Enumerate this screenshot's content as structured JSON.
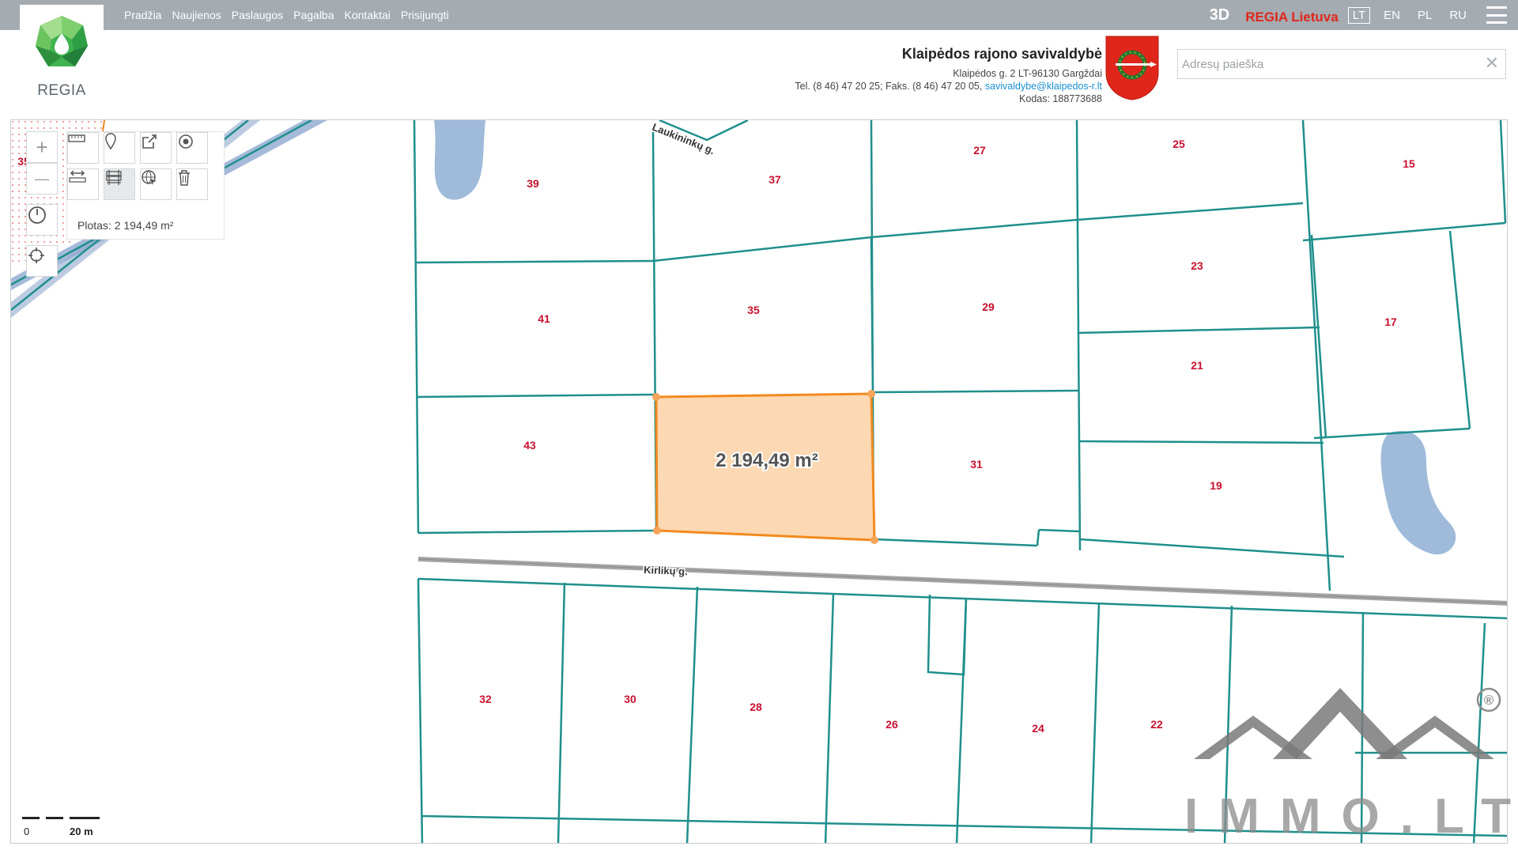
{
  "header": {
    "nav": [
      "Pradžia",
      "Naujienos",
      "Paslaugos",
      "Pagalba",
      "Kontaktai",
      "Prisijungti"
    ],
    "btn_3d": "3D",
    "regia_lietuva": "REGIA Lietuva",
    "languages": [
      "LT",
      "EN",
      "PL",
      "RU"
    ],
    "active_language": "LT",
    "logo_text": "REGIA"
  },
  "municipality": {
    "name": "Klaipėdos rajono savivaldybė",
    "address": "Klaipėdos g. 2 LT-96130 Gargždai",
    "phone": "Tel. (8 46) 47 20 25; Faks. (8 46) 47 20 05,",
    "email": "savivaldybe@klaipedos-r.lt",
    "code": "Kodas: 188773688"
  },
  "search": {
    "placeholder": "Adresų paieška",
    "clear": "✕"
  },
  "tools": {
    "zoom_in": "+",
    "zoom_out": "—",
    "area_label": "Plotas: 2 194,49 m²"
  },
  "map": {
    "selected_area": "2 194,49 m²",
    "streets": [
      "Laukininkų g.",
      "Kirlikų g."
    ],
    "parcels": [
      "39",
      "37",
      "27",
      "25",
      "15",
      "41",
      "35",
      "29",
      "23",
      "17",
      "21",
      "43",
      "31",
      "19",
      "32",
      "30",
      "28",
      "26",
      "24",
      "22",
      "35"
    ],
    "scale_zero": "0",
    "scale_value": "20 m",
    "colors": {
      "parcel_line": "#1f8f8c",
      "selection_fill": "#fcd8b3",
      "selection_stroke": "#f28a1e",
      "parcel_label": "#c8102e",
      "water": "#9fbbd9"
    }
  },
  "watermark": {
    "text": "IMMO.LT",
    "registered": "®"
  }
}
